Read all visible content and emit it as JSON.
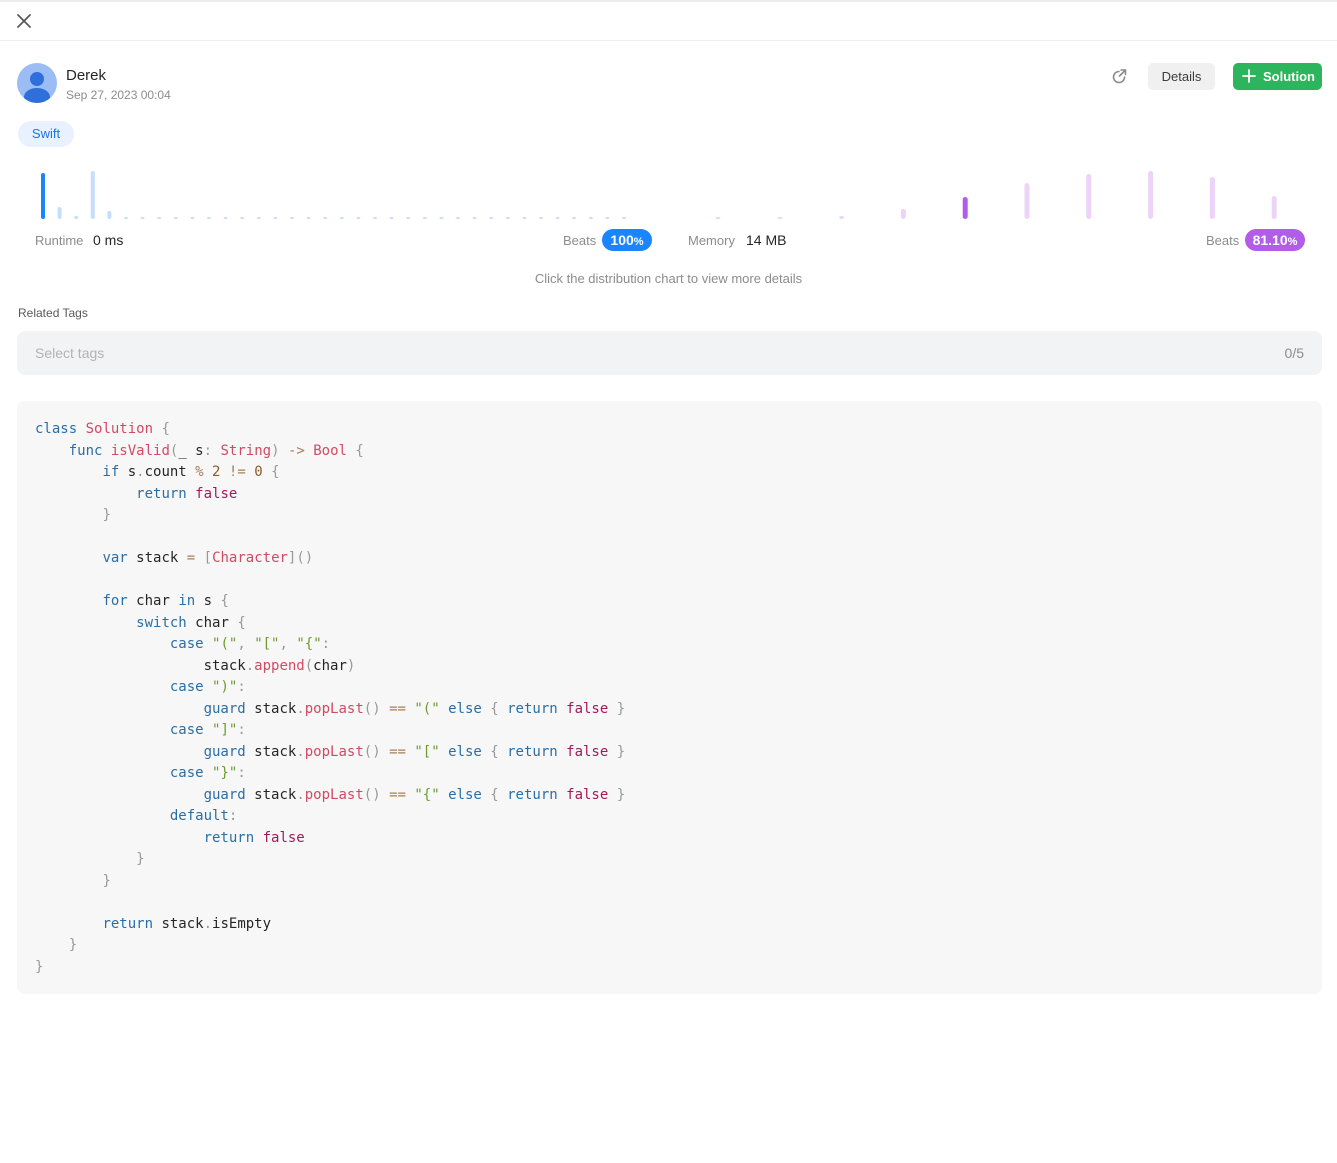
{
  "icons": {
    "close": "close-icon",
    "share": "share-icon",
    "plus": "plus-icon",
    "avatar": "user-avatar-icon"
  },
  "author": {
    "name": "Derek",
    "date": "Sep 27, 2023 00:04"
  },
  "actions": {
    "details_label": "Details",
    "solution_label": "Solution"
  },
  "language_tag": "Swift",
  "colors": {
    "runtime_accent": "#1a85ff",
    "runtime_light": "#c5defb",
    "memory_accent": "#b25de8",
    "memory_light": "#ecd3f7",
    "solution_green": "#2db55d"
  },
  "stats": {
    "runtime_label": "Runtime",
    "runtime_value": "0 ms",
    "runtime_beats_label": "Beats",
    "runtime_beats_value": "100",
    "memory_label": "Memory",
    "memory_value": "14 MB",
    "memory_beats_label": "Beats",
    "memory_beats_value": "81.10"
  },
  "chart_data": [
    {
      "type": "bar",
      "name": "runtime-distribution",
      "values": [
        46,
        12,
        3,
        48,
        8,
        1,
        1,
        1,
        1,
        1,
        1,
        1,
        1,
        1,
        1,
        1,
        1,
        1,
        1,
        1,
        1,
        1,
        1,
        1,
        1,
        1,
        1,
        1,
        1,
        1,
        1,
        1,
        1,
        1,
        1,
        1
      ],
      "highlight_index": 0
    },
    {
      "type": "bar",
      "name": "memory-distribution",
      "values": [
        1,
        1,
        3,
        10,
        22,
        36,
        45,
        48,
        42,
        23
      ],
      "highlight_index": 4
    }
  ],
  "hint": "Click the distribution chart to view more details",
  "related_tags": {
    "label": "Related Tags",
    "placeholder": "Select tags",
    "count": "0/5"
  },
  "code": {
    "language": "swift",
    "lines": [
      [
        [
          "kw",
          "class"
        ],
        [
          "pl",
          " "
        ],
        [
          "ty",
          "Solution"
        ],
        [
          "pl",
          " "
        ],
        [
          "p",
          "{"
        ]
      ],
      [
        [
          "pl",
          "    "
        ],
        [
          "kw",
          "func"
        ],
        [
          "pl",
          " "
        ],
        [
          "ty",
          "isValid"
        ],
        [
          "p",
          "("
        ],
        [
          "pl",
          "_ s"
        ],
        [
          "p",
          ":"
        ],
        [
          "pl",
          " "
        ],
        [
          "ty",
          "String"
        ],
        [
          "p",
          ")"
        ],
        [
          "pl",
          " "
        ],
        [
          "op",
          "->"
        ],
        [
          "pl",
          " "
        ],
        [
          "ty",
          "Bool"
        ],
        [
          "pl",
          " "
        ],
        [
          "p",
          "{"
        ]
      ],
      [
        [
          "pl",
          "        "
        ],
        [
          "kw",
          "if"
        ],
        [
          "pl",
          " s"
        ],
        [
          "p",
          "."
        ],
        [
          "pl",
          "count "
        ],
        [
          "op",
          "%"
        ],
        [
          "pl",
          " "
        ],
        [
          "num",
          "2"
        ],
        [
          "pl",
          " "
        ],
        [
          "op",
          "!="
        ],
        [
          "pl",
          " "
        ],
        [
          "num",
          "0"
        ],
        [
          "pl",
          " "
        ],
        [
          "p",
          "{"
        ]
      ],
      [
        [
          "pl",
          "            "
        ],
        [
          "kw",
          "return"
        ],
        [
          "pl",
          " "
        ],
        [
          "lit",
          "false"
        ]
      ],
      [
        [
          "pl",
          "        "
        ],
        [
          "p",
          "}"
        ]
      ],
      [],
      [
        [
          "pl",
          "        "
        ],
        [
          "kw",
          "var"
        ],
        [
          "pl",
          " stack "
        ],
        [
          "op",
          "="
        ],
        [
          "pl",
          " "
        ],
        [
          "p",
          "["
        ],
        [
          "ty",
          "Character"
        ],
        [
          "p",
          "]()"
        ]
      ],
      [],
      [
        [
          "pl",
          "        "
        ],
        [
          "kw",
          "for"
        ],
        [
          "pl",
          " char "
        ],
        [
          "kw",
          "in"
        ],
        [
          "pl",
          " s "
        ],
        [
          "p",
          "{"
        ]
      ],
      [
        [
          "pl",
          "            "
        ],
        [
          "kw",
          "switch"
        ],
        [
          "pl",
          " char "
        ],
        [
          "p",
          "{"
        ]
      ],
      [
        [
          "pl",
          "                "
        ],
        [
          "kw",
          "case"
        ],
        [
          "pl",
          " "
        ],
        [
          "str",
          "\"(\""
        ],
        [
          "p",
          ","
        ],
        [
          "pl",
          " "
        ],
        [
          "str",
          "\"[\""
        ],
        [
          "p",
          ","
        ],
        [
          "pl",
          " "
        ],
        [
          "str",
          "\"{\""
        ],
        [
          "p",
          ":"
        ]
      ],
      [
        [
          "pl",
          "                    stack"
        ],
        [
          "p",
          "."
        ],
        [
          "ty",
          "append"
        ],
        [
          "p",
          "("
        ],
        [
          "pl",
          "char"
        ],
        [
          "p",
          ")"
        ]
      ],
      [
        [
          "pl",
          "                "
        ],
        [
          "kw",
          "case"
        ],
        [
          "pl",
          " "
        ],
        [
          "str",
          "\")\""
        ],
        [
          "p",
          ":"
        ]
      ],
      [
        [
          "pl",
          "                    "
        ],
        [
          "kw",
          "guard"
        ],
        [
          "pl",
          " stack"
        ],
        [
          "p",
          "."
        ],
        [
          "ty",
          "popLast"
        ],
        [
          "p",
          "()"
        ],
        [
          "pl",
          " "
        ],
        [
          "op",
          "=="
        ],
        [
          "pl",
          " "
        ],
        [
          "str",
          "\"(\""
        ],
        [
          "pl",
          " "
        ],
        [
          "kw",
          "else"
        ],
        [
          "pl",
          " "
        ],
        [
          "p",
          "{"
        ],
        [
          "pl",
          " "
        ],
        [
          "kw",
          "return"
        ],
        [
          "pl",
          " "
        ],
        [
          "lit",
          "false"
        ],
        [
          "pl",
          " "
        ],
        [
          "p",
          "}"
        ]
      ],
      [
        [
          "pl",
          "                "
        ],
        [
          "kw",
          "case"
        ],
        [
          "pl",
          " "
        ],
        [
          "str",
          "\"]\""
        ],
        [
          "p",
          ":"
        ]
      ],
      [
        [
          "pl",
          "                    "
        ],
        [
          "kw",
          "guard"
        ],
        [
          "pl",
          " stack"
        ],
        [
          "p",
          "."
        ],
        [
          "ty",
          "popLast"
        ],
        [
          "p",
          "()"
        ],
        [
          "pl",
          " "
        ],
        [
          "op",
          "=="
        ],
        [
          "pl",
          " "
        ],
        [
          "str",
          "\"[\""
        ],
        [
          "pl",
          " "
        ],
        [
          "kw",
          "else"
        ],
        [
          "pl",
          " "
        ],
        [
          "p",
          "{"
        ],
        [
          "pl",
          " "
        ],
        [
          "kw",
          "return"
        ],
        [
          "pl",
          " "
        ],
        [
          "lit",
          "false"
        ],
        [
          "pl",
          " "
        ],
        [
          "p",
          "}"
        ]
      ],
      [
        [
          "pl",
          "                "
        ],
        [
          "kw",
          "case"
        ],
        [
          "pl",
          " "
        ],
        [
          "str",
          "\"}\""
        ],
        [
          "p",
          ":"
        ]
      ],
      [
        [
          "pl",
          "                    "
        ],
        [
          "kw",
          "guard"
        ],
        [
          "pl",
          " stack"
        ],
        [
          "p",
          "."
        ],
        [
          "ty",
          "popLast"
        ],
        [
          "p",
          "()"
        ],
        [
          "pl",
          " "
        ],
        [
          "op",
          "=="
        ],
        [
          "pl",
          " "
        ],
        [
          "str",
          "\"{\""
        ],
        [
          "pl",
          " "
        ],
        [
          "kw",
          "else"
        ],
        [
          "pl",
          " "
        ],
        [
          "p",
          "{"
        ],
        [
          "pl",
          " "
        ],
        [
          "kw",
          "return"
        ],
        [
          "pl",
          " "
        ],
        [
          "lit",
          "false"
        ],
        [
          "pl",
          " "
        ],
        [
          "p",
          "}"
        ]
      ],
      [
        [
          "pl",
          "                "
        ],
        [
          "kw",
          "default"
        ],
        [
          "p",
          ":"
        ]
      ],
      [
        [
          "pl",
          "                    "
        ],
        [
          "kw",
          "return"
        ],
        [
          "pl",
          " "
        ],
        [
          "lit",
          "false"
        ]
      ],
      [
        [
          "pl",
          "            "
        ],
        [
          "p",
          "}"
        ]
      ],
      [
        [
          "pl",
          "        "
        ],
        [
          "p",
          "}"
        ]
      ],
      [],
      [
        [
          "pl",
          "        "
        ],
        [
          "kw",
          "return"
        ],
        [
          "pl",
          " stack"
        ],
        [
          "p",
          "."
        ],
        [
          "pl",
          "isEmpty"
        ]
      ],
      [
        [
          "pl",
          "    "
        ],
        [
          "p",
          "}"
        ]
      ],
      [
        [
          "p",
          "}"
        ]
      ]
    ]
  }
}
